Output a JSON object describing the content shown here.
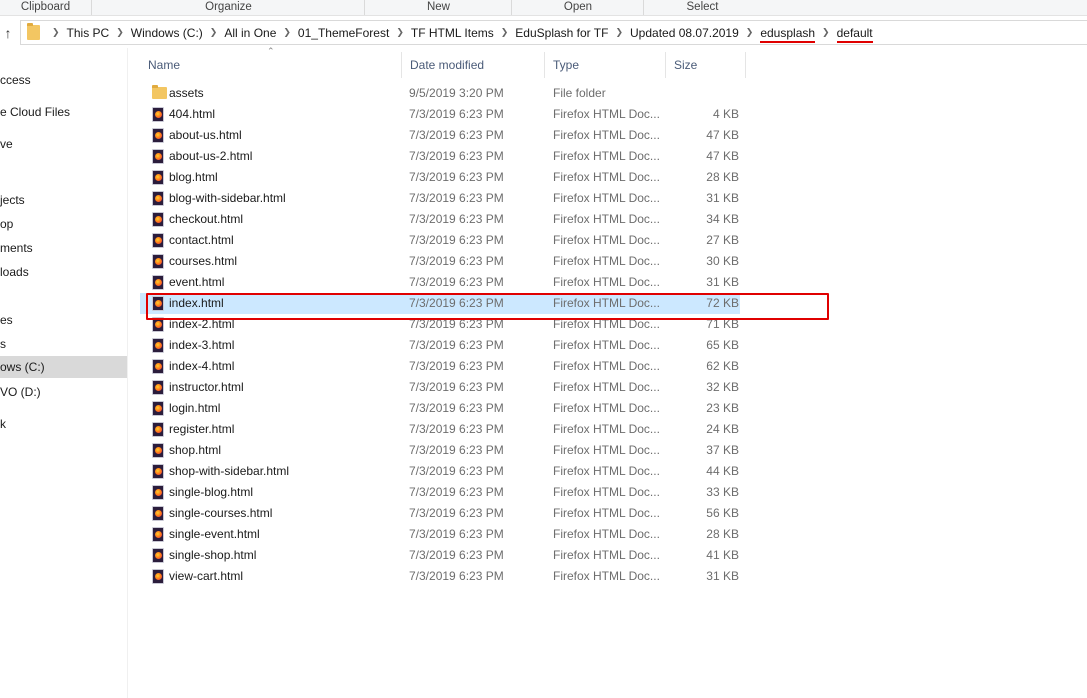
{
  "ribbon": {
    "groups": [
      "Clipboard",
      "Organize",
      "New",
      "Open",
      "Select"
    ]
  },
  "address_bar": {
    "breadcrumbs": [
      "This PC",
      "Windows (C:)",
      "All in One",
      "01_ThemeForest",
      "TF HTML Items",
      "EduSplash for TF",
      "Updated 08.07.2019",
      "edusplash",
      "default"
    ],
    "highlighted_crumbs": [
      "edusplash",
      "default"
    ],
    "icons": [
      "up-arrow-icon",
      "folder-icon",
      "chevron-right-icon"
    ]
  },
  "nav_pane": {
    "items": [
      "ccess",
      "e Cloud Files",
      "ve",
      "jects",
      "op",
      "ments",
      "loads",
      "es",
      "s",
      "ows (C:)",
      "VO (D:)",
      "k"
    ],
    "selected_item": "ows (C:)"
  },
  "columns": {
    "name": "Name",
    "date": "Date modified",
    "type": "Type",
    "size": "Size"
  },
  "files": [
    {
      "name": "assets",
      "date": "9/5/2019 3:20 PM",
      "type": "File folder",
      "size": "",
      "icon": "folder-icon"
    },
    {
      "name": "404.html",
      "date": "7/3/2019 6:23 PM",
      "type": "Firefox HTML Doc...",
      "size": "4 KB",
      "icon": "firefox-html-icon"
    },
    {
      "name": "about-us.html",
      "date": "7/3/2019 6:23 PM",
      "type": "Firefox HTML Doc...",
      "size": "47 KB",
      "icon": "firefox-html-icon"
    },
    {
      "name": "about-us-2.html",
      "date": "7/3/2019 6:23 PM",
      "type": "Firefox HTML Doc...",
      "size": "47 KB",
      "icon": "firefox-html-icon"
    },
    {
      "name": "blog.html",
      "date": "7/3/2019 6:23 PM",
      "type": "Firefox HTML Doc...",
      "size": "28 KB",
      "icon": "firefox-html-icon"
    },
    {
      "name": "blog-with-sidebar.html",
      "date": "7/3/2019 6:23 PM",
      "type": "Firefox HTML Doc...",
      "size": "31 KB",
      "icon": "firefox-html-icon"
    },
    {
      "name": "checkout.html",
      "date": "7/3/2019 6:23 PM",
      "type": "Firefox HTML Doc...",
      "size": "34 KB",
      "icon": "firefox-html-icon"
    },
    {
      "name": "contact.html",
      "date": "7/3/2019 6:23 PM",
      "type": "Firefox HTML Doc...",
      "size": "27 KB",
      "icon": "firefox-html-icon"
    },
    {
      "name": "courses.html",
      "date": "7/3/2019 6:23 PM",
      "type": "Firefox HTML Doc...",
      "size": "30 KB",
      "icon": "firefox-html-icon"
    },
    {
      "name": "event.html",
      "date": "7/3/2019 6:23 PM",
      "type": "Firefox HTML Doc...",
      "size": "31 KB",
      "icon": "firefox-html-icon"
    },
    {
      "name": "index.html",
      "date": "7/3/2019 6:23 PM",
      "type": "Firefox HTML Doc...",
      "size": "72 KB",
      "icon": "firefox-html-icon",
      "selected": true
    },
    {
      "name": "index-2.html",
      "date": "7/3/2019 6:23 PM",
      "type": "Firefox HTML Doc...",
      "size": "71 KB",
      "icon": "firefox-html-icon"
    },
    {
      "name": "index-3.html",
      "date": "7/3/2019 6:23 PM",
      "type": "Firefox HTML Doc...",
      "size": "65 KB",
      "icon": "firefox-html-icon"
    },
    {
      "name": "index-4.html",
      "date": "7/3/2019 6:23 PM",
      "type": "Firefox HTML Doc...",
      "size": "62 KB",
      "icon": "firefox-html-icon"
    },
    {
      "name": "instructor.html",
      "date": "7/3/2019 6:23 PM",
      "type": "Firefox HTML Doc...",
      "size": "32 KB",
      "icon": "firefox-html-icon"
    },
    {
      "name": "login.html",
      "date": "7/3/2019 6:23 PM",
      "type": "Firefox HTML Doc...",
      "size": "23 KB",
      "icon": "firefox-html-icon"
    },
    {
      "name": "register.html",
      "date": "7/3/2019 6:23 PM",
      "type": "Firefox HTML Doc...",
      "size": "24 KB",
      "icon": "firefox-html-icon"
    },
    {
      "name": "shop.html",
      "date": "7/3/2019 6:23 PM",
      "type": "Firefox HTML Doc...",
      "size": "37 KB",
      "icon": "firefox-html-icon"
    },
    {
      "name": "shop-with-sidebar.html",
      "date": "7/3/2019 6:23 PM",
      "type": "Firefox HTML Doc...",
      "size": "44 KB",
      "icon": "firefox-html-icon"
    },
    {
      "name": "single-blog.html",
      "date": "7/3/2019 6:23 PM",
      "type": "Firefox HTML Doc...",
      "size": "33 KB",
      "icon": "firefox-html-icon"
    },
    {
      "name": "single-courses.html",
      "date": "7/3/2019 6:23 PM",
      "type": "Firefox HTML Doc...",
      "size": "56 KB",
      "icon": "firefox-html-icon"
    },
    {
      "name": "single-event.html",
      "date": "7/3/2019 6:23 PM",
      "type": "Firefox HTML Doc...",
      "size": "28 KB",
      "icon": "firefox-html-icon"
    },
    {
      "name": "single-shop.html",
      "date": "7/3/2019 6:23 PM",
      "type": "Firefox HTML Doc...",
      "size": "41 KB",
      "icon": "firefox-html-icon"
    },
    {
      "name": "view-cart.html",
      "date": "7/3/2019 6:23 PM",
      "type": "Firefox HTML Doc...",
      "size": "31 KB",
      "icon": "firefox-html-icon"
    }
  ],
  "colors": {
    "selection": "#cce8ff",
    "annotation": "#e00000",
    "nav_selected": "#d9d9d9",
    "folder": "#f3c662"
  }
}
